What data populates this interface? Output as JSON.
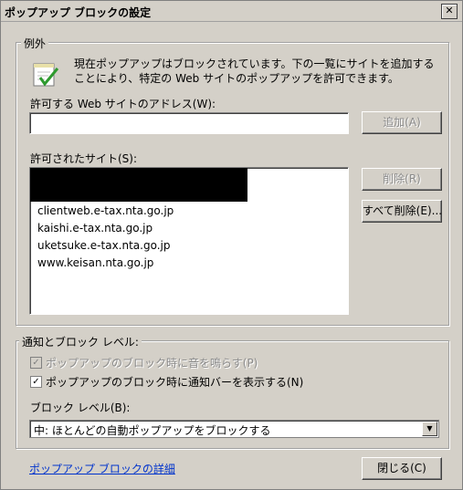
{
  "window": {
    "title": "ポップアップ ブロックの設定",
    "close_glyph": "✕"
  },
  "exceptions": {
    "legend": "例外",
    "description": "現在ポップアップはブロックされています。下の一覧にサイトを追加することにより、特定の Web サイトのポップアップを許可できます。",
    "address_label": "許可する Web サイトのアドレス(W):",
    "address_value": "",
    "add_button": "追加(A)",
    "allowed_label": "許可されたサイト(S):",
    "allowed_sites": [
      "",
      "clientweb.e-tax.nta.go.jp",
      "kaishi.e-tax.nta.go.jp",
      "uketsuke.e-tax.nta.go.jp",
      "www.keisan.nta.go.jp"
    ],
    "remove_button": "削除(R)",
    "remove_all_button": "すべて削除(E)..."
  },
  "notify": {
    "legend": "通知とブロック レベル:",
    "sound_label": "ポップアップのブロック時に音を鳴らす(P)",
    "sound_checked": true,
    "bar_label": "ポップアップのブロック時に通知バーを表示する(N)",
    "bar_checked": true,
    "level_label": "ブロック レベル(B):",
    "level_value": "中: ほとんどの自動ポップアップをブロックする"
  },
  "footer": {
    "learn_more_link": "ポップアップ ブロックの詳細",
    "close_button": "閉じる(C)"
  },
  "colors": {
    "dialog_bg": "#d4d0c8",
    "link": "#0033cc",
    "disabled_text": "#8a8a8a"
  }
}
